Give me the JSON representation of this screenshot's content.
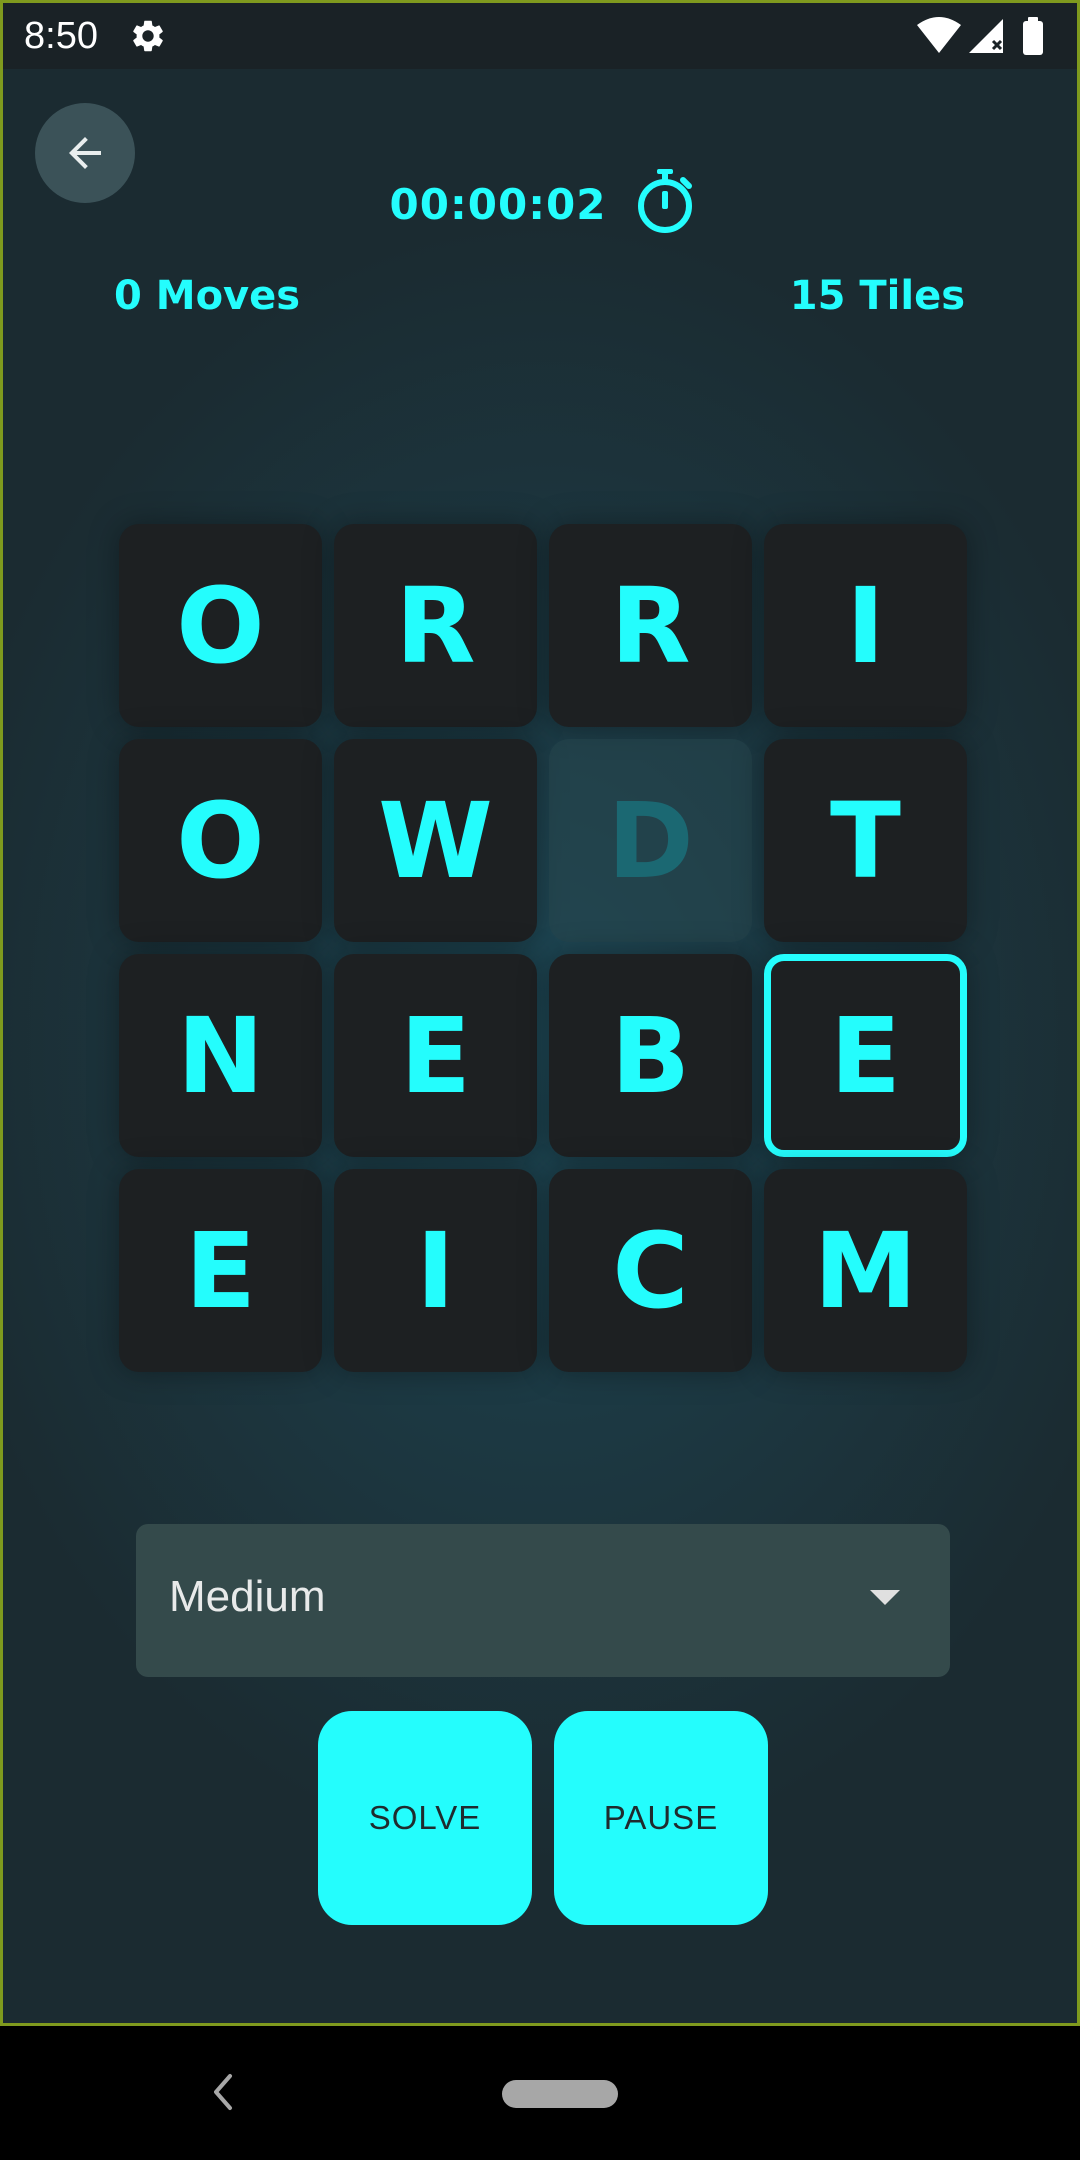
{
  "status_bar": {
    "time": "8:50",
    "icons": [
      "gear-icon",
      "wifi-icon",
      "signal-icon",
      "battery-icon"
    ]
  },
  "header": {
    "back_icon": "arrow-left-icon",
    "timer": "00:00:02",
    "timer_icon": "stopwatch-icon",
    "moves": "0 Moves",
    "tiles": "15 Tiles"
  },
  "board": {
    "tiles": [
      {
        "letter": "O",
        "state": "normal"
      },
      {
        "letter": "R",
        "state": "normal"
      },
      {
        "letter": "R",
        "state": "normal"
      },
      {
        "letter": "I",
        "state": "normal"
      },
      {
        "letter": "O",
        "state": "normal"
      },
      {
        "letter": "W",
        "state": "normal"
      },
      {
        "letter": "D",
        "state": "empty"
      },
      {
        "letter": "T",
        "state": "normal"
      },
      {
        "letter": "N",
        "state": "normal"
      },
      {
        "letter": "E",
        "state": "normal"
      },
      {
        "letter": "B",
        "state": "normal"
      },
      {
        "letter": "E",
        "state": "selected"
      },
      {
        "letter": "E",
        "state": "normal"
      },
      {
        "letter": "I",
        "state": "normal"
      },
      {
        "letter": "C",
        "state": "normal"
      },
      {
        "letter": "M",
        "state": "normal"
      }
    ]
  },
  "difficulty": {
    "value": "Medium",
    "arrow_icon": "dropdown-arrow-icon"
  },
  "actions": {
    "solve_label": "SOLVE",
    "pause_label": "PAUSE"
  },
  "navigation": {
    "back_icon": "nav-back-icon",
    "home_icon": "nav-home-pill"
  },
  "colors": {
    "accent": "#24fdfd",
    "tile_bg": "#1d2022",
    "empty_tile_text": "#1b6872",
    "dropdown_bg": "#344a4b"
  }
}
